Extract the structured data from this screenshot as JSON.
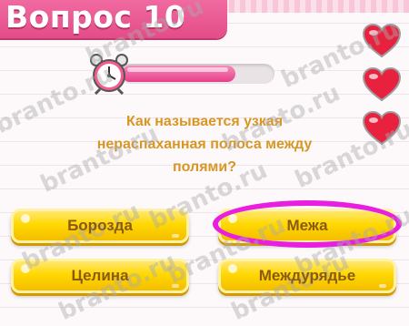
{
  "header": {
    "title": "Вопрос 10"
  },
  "lives": {
    "count": 3,
    "color": "#e8213e"
  },
  "timer": {
    "remaining_fraction": 0.75,
    "color": "#e6408a"
  },
  "question": {
    "lines": [
      "Как называется узкая",
      "нераспаханная полоса между",
      "полями?"
    ]
  },
  "answers": [
    {
      "label": "Борозда",
      "selected": false
    },
    {
      "label": "Межа",
      "selected": true
    },
    {
      "label": "Целина",
      "selected": false
    },
    {
      "label": "Междурядье",
      "selected": false
    }
  ],
  "highlight_color": "#e81ee0",
  "watermark": {
    "text": "branto.ru"
  }
}
